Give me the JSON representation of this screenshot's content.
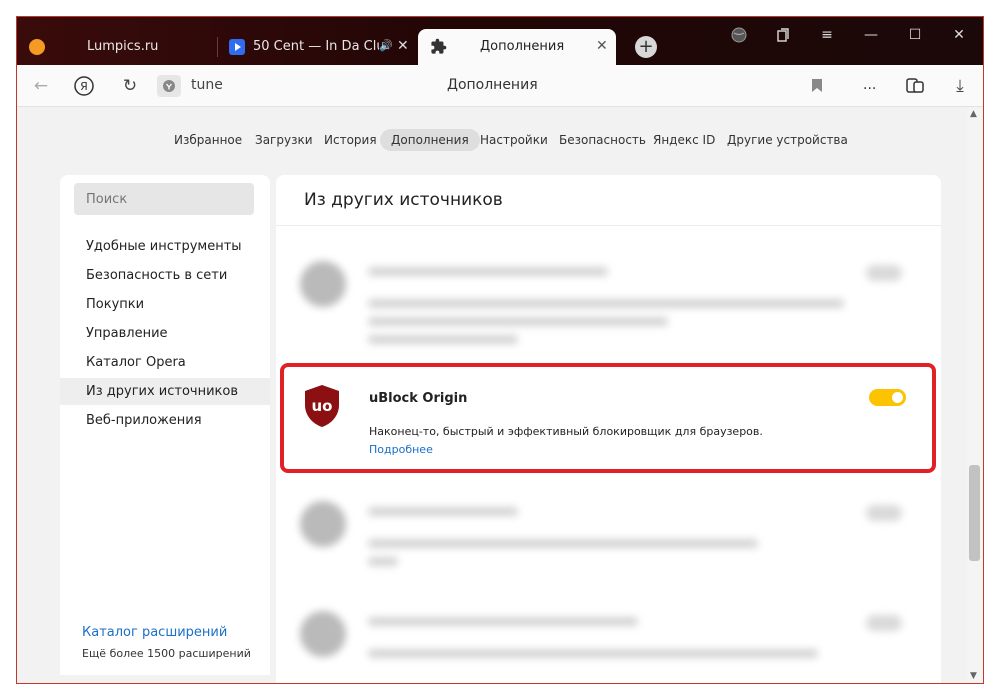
{
  "tabs": [
    {
      "label": "Lumpics.ru",
      "icon": "orange-circle-icon",
      "icon_color": "#f59a23"
    },
    {
      "label": "50 Cent — In Da Club",
      "icon": "youtube-play-icon",
      "icon_color": "#2f6cf0"
    },
    {
      "label": "Дополнения",
      "icon": "puzzle-icon"
    }
  ],
  "addressbar": {
    "url": "tune",
    "page_title": "Дополнения",
    "menu_label": "..."
  },
  "nav": [
    "Избранное",
    "Загрузки",
    "История",
    "Дополнения",
    "Настройки",
    "Безопасность",
    "Яндекс ID",
    "Другие устройства"
  ],
  "nav_active": "Дополнения",
  "sidebar": {
    "search_placeholder": "Поиск",
    "items": [
      "Удобные инструменты",
      "Безопасность в сети",
      "Покупки",
      "Управление",
      "Каталог Opera",
      "Из других источников",
      "Веб-приложения"
    ],
    "active": "Из других источников",
    "catalog_link": "Каталог расширений",
    "catalog_sub": "Ещё более 1500 расширений"
  },
  "section_title": "Из других источников",
  "extension": {
    "name": "uBlock Origin",
    "description": "Наконец-то, быстрый и эффективный блокировщик для браузеров.",
    "more_link": "Подробнее",
    "enabled": true,
    "toggle_color": "#fcc300",
    "icon_color": "#8c0f12",
    "highlight_color": "#e02127"
  }
}
